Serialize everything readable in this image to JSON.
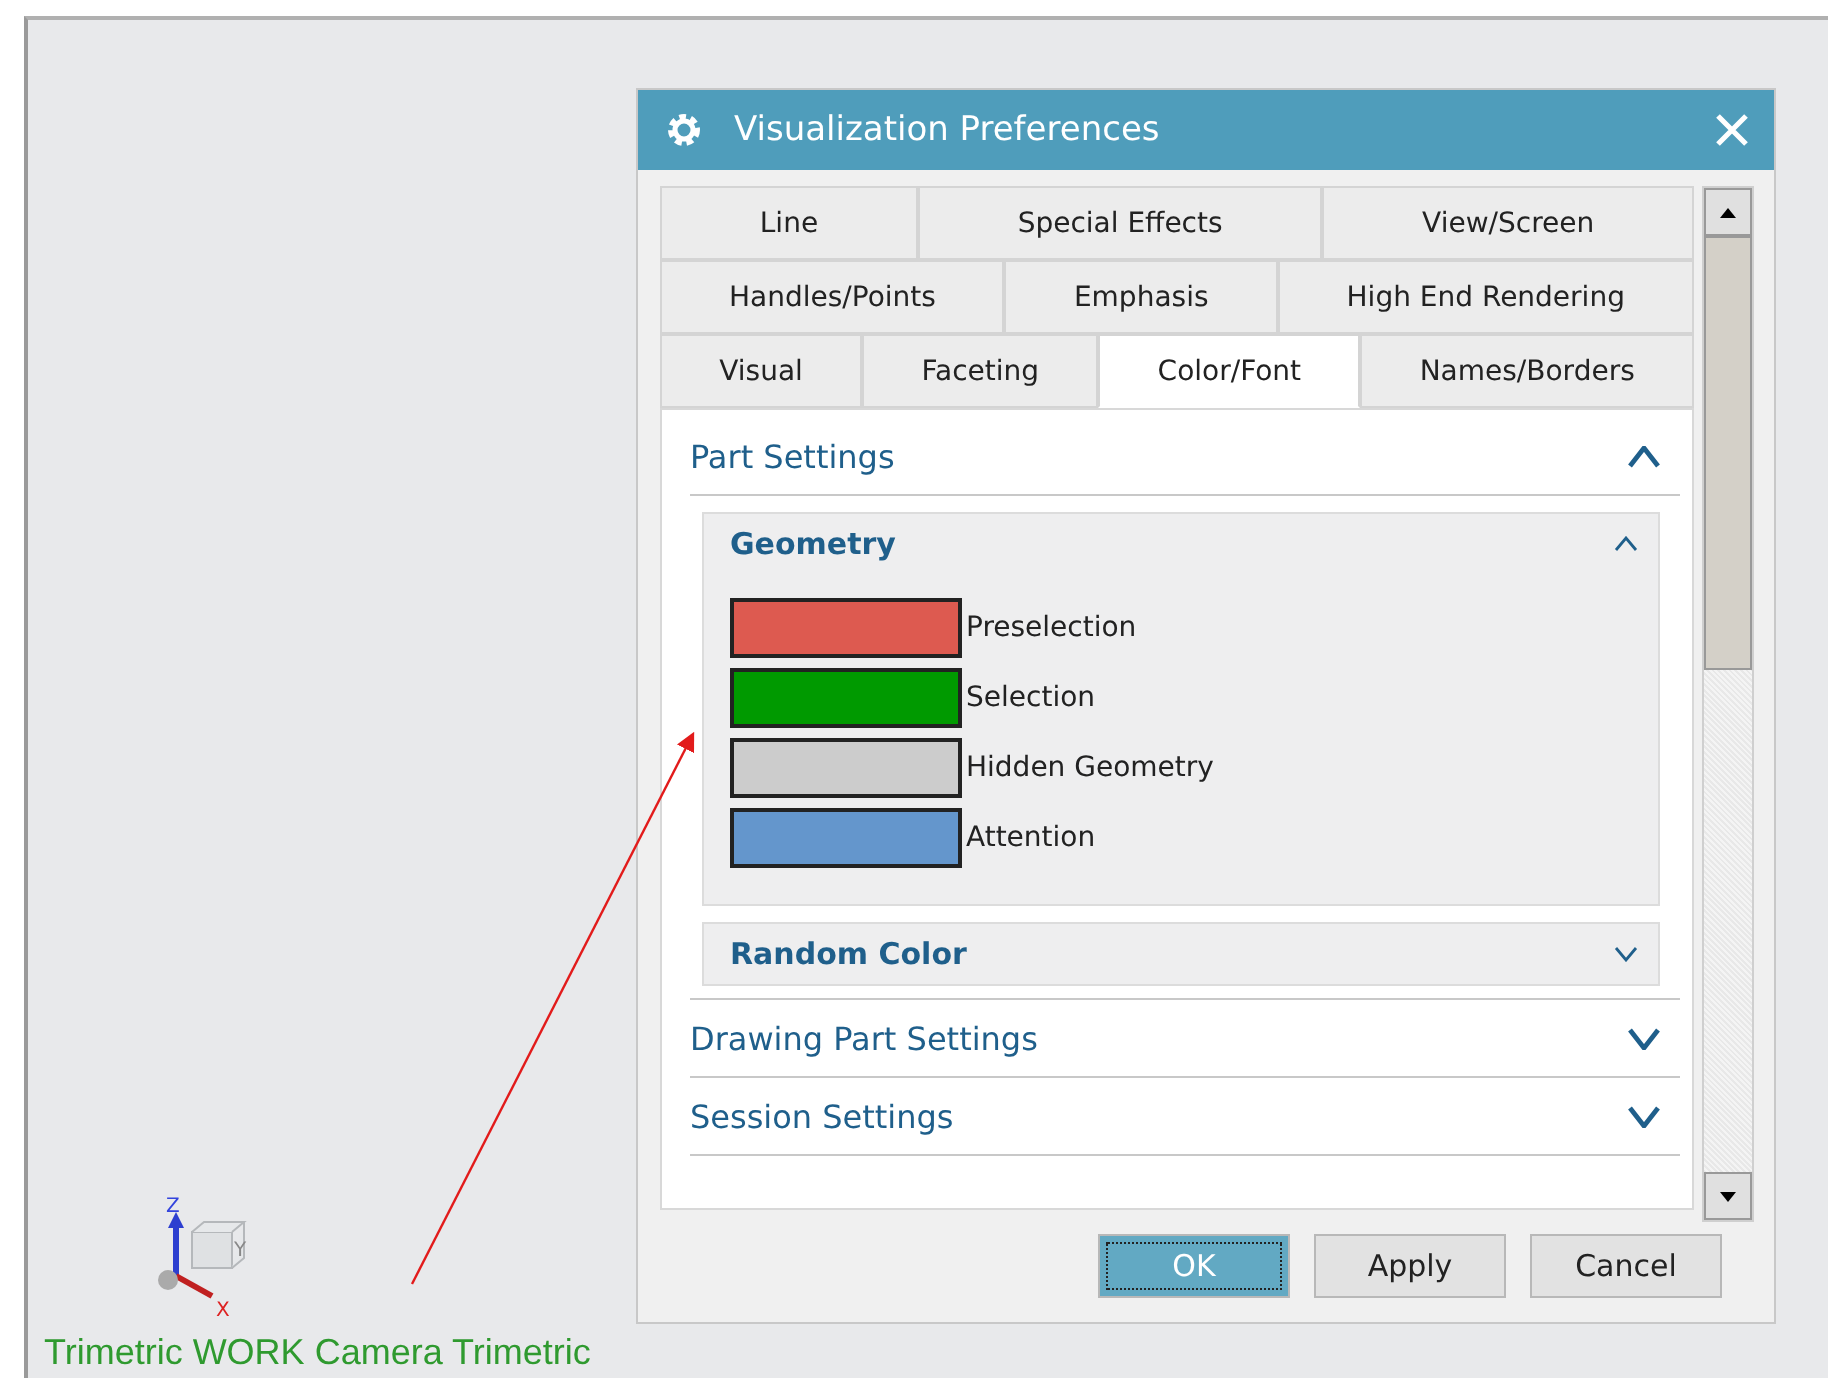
{
  "viewport": {
    "axis_labels": [
      "Z",
      "Y",
      "X"
    ],
    "view_label": "Trimetric WORK Camera Trimetric"
  },
  "dialog": {
    "title": "Visualization Preferences",
    "tab_rows": [
      [
        {
          "label": "Line",
          "selected": false
        },
        {
          "label": "Special Effects",
          "selected": false
        },
        {
          "label": "View/Screen",
          "selected": false
        }
      ],
      [
        {
          "label": "Handles/Points",
          "selected": false
        },
        {
          "label": "Emphasis",
          "selected": false
        },
        {
          "label": "High End Rendering",
          "selected": false
        }
      ],
      [
        {
          "label": "Visual",
          "selected": false
        },
        {
          "label": "Faceting",
          "selected": false
        },
        {
          "label": "Color/Font",
          "selected": true
        },
        {
          "label": "Names/Borders",
          "selected": false
        }
      ]
    ],
    "sections": [
      {
        "title": "Part Settings",
        "expanded": true,
        "groups": [
          {
            "title": "Geometry",
            "expanded": true,
            "colors": [
              {
                "label": "Preselection",
                "color": "#dd5a50"
              },
              {
                "label": "Selection",
                "color": "#009a00"
              },
              {
                "label": "Hidden Geometry",
                "color": "#cccccc"
              },
              {
                "label": "Attention",
                "color": "#6496cc"
              }
            ]
          },
          {
            "title": "Random Color",
            "expanded": false
          }
        ]
      },
      {
        "title": "Drawing Part Settings",
        "expanded": false
      },
      {
        "title": "Session Settings",
        "expanded": false
      }
    ],
    "buttons": [
      {
        "label": "OK",
        "focused": true
      },
      {
        "label": "Apply",
        "focused": false
      },
      {
        "label": "Cancel",
        "focused": false
      }
    ]
  }
}
